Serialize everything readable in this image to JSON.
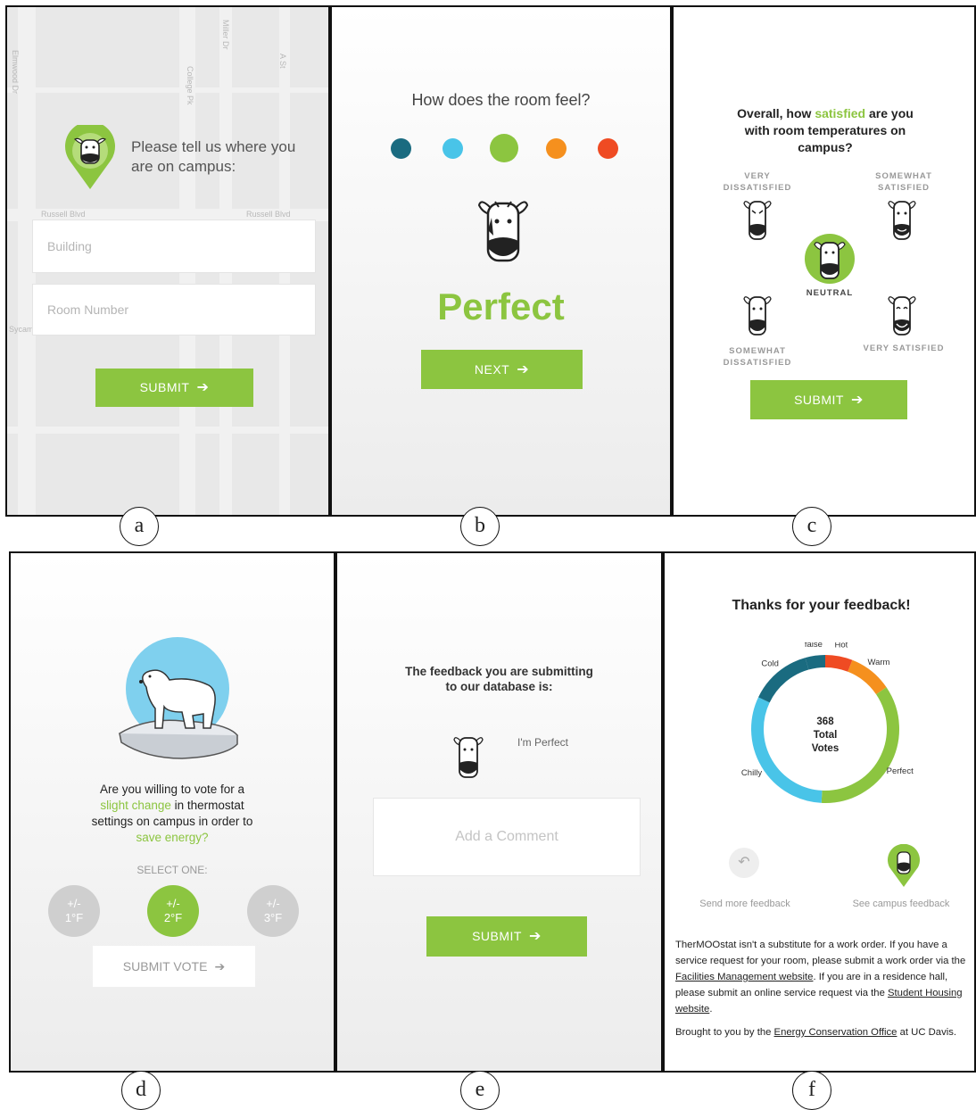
{
  "labels": {
    "a": "a",
    "b": "b",
    "c": "c",
    "d": "d",
    "e": "e",
    "f": "f"
  },
  "panel_a": {
    "prompt": "Please tell us where you are on campus:",
    "building_placeholder": "Building",
    "room_placeholder": "Room Number",
    "submit_label": "SUBMIT",
    "map_labels": [
      "Elmwood Dr",
      "College Pk",
      "Miller Dr",
      "A St",
      "Russell Blvd",
      "Russell Blvd",
      "Sycamore Ln"
    ]
  },
  "panel_b": {
    "question": "How does the room feel?",
    "scale_colors": [
      "#1a6b80",
      "#49c4e8",
      "#8cc540",
      "#f5901e",
      "#ef4b23"
    ],
    "selected_index": 2,
    "feeling": "Perfect",
    "next_label": "NEXT"
  },
  "panel_c": {
    "question_start": "Overall, how ",
    "question_highlight": "satisfied",
    "question_end": " are you with room temperatures on campus?",
    "options": {
      "very_dissatisfied": "VERY DISSATISFIED",
      "somewhat_satisfied": "SOMEWHAT SATISFIED",
      "neutral": "NEUTRAL",
      "somewhat_dissatisfied": "SOMEWHAT DISSATISFIED",
      "very_satisfied": "VERY SATISFIED"
    },
    "selected": "neutral",
    "submit_label": "SUBMIT"
  },
  "panel_d": {
    "q1": "Are you willing to vote for a",
    "q2_highlight": "slight change",
    "q2_rest": " in thermostat",
    "q3": "settings on campus in order to",
    "q4_highlight": "save energy?",
    "select_one": "SELECT ONE:",
    "choices": [
      {
        "pm": "+/-",
        "value": "1°F"
      },
      {
        "pm": "+/-",
        "value": "2°F"
      },
      {
        "pm": "+/-",
        "value": "3°F"
      }
    ],
    "selected_index": 1,
    "submit_vote_label": "SUBMIT VOTE"
  },
  "panel_e": {
    "heading_line1": "The feedback you are submitting",
    "heading_line2": "to our database is:",
    "feedback_text": "I'm Perfect",
    "comment_placeholder": "Add a Comment",
    "submit_label": "SUBMIT"
  },
  "panel_f": {
    "title": "Thanks for your feedback!",
    "total_number": "368",
    "total_word1": "Total",
    "total_word2": "Votes",
    "actions": {
      "send_more": "Send more feedback",
      "see_campus": "See campus feedback"
    },
    "disclaimer": {
      "t1": "TherMOOstat isn't a substitute for a work order. If you have a service request for your room, please submit a work order via the ",
      "link1": "Facilities Management website",
      "t2": ". If you are in a residence hall, please submit an online service request via the ",
      "link2": "Student Housing website",
      "t3": "."
    },
    "credit": {
      "t1": "Brought to you by the ",
      "link": "Energy Conservation Office",
      "t2": " at UC Davis."
    }
  },
  "chart_data": {
    "type": "pie",
    "categories": [
      "Hot",
      "Warm",
      "Perfect",
      "Chilly",
      "Cold",
      "false"
    ],
    "values": [
      22,
      35,
      130,
      115,
      50,
      16
    ],
    "colors": [
      "#ef4b23",
      "#f5901e",
      "#8cc540",
      "#49c4e8",
      "#1a6b80",
      "#1a6b80"
    ],
    "title": "",
    "legend": "labels around ring"
  }
}
